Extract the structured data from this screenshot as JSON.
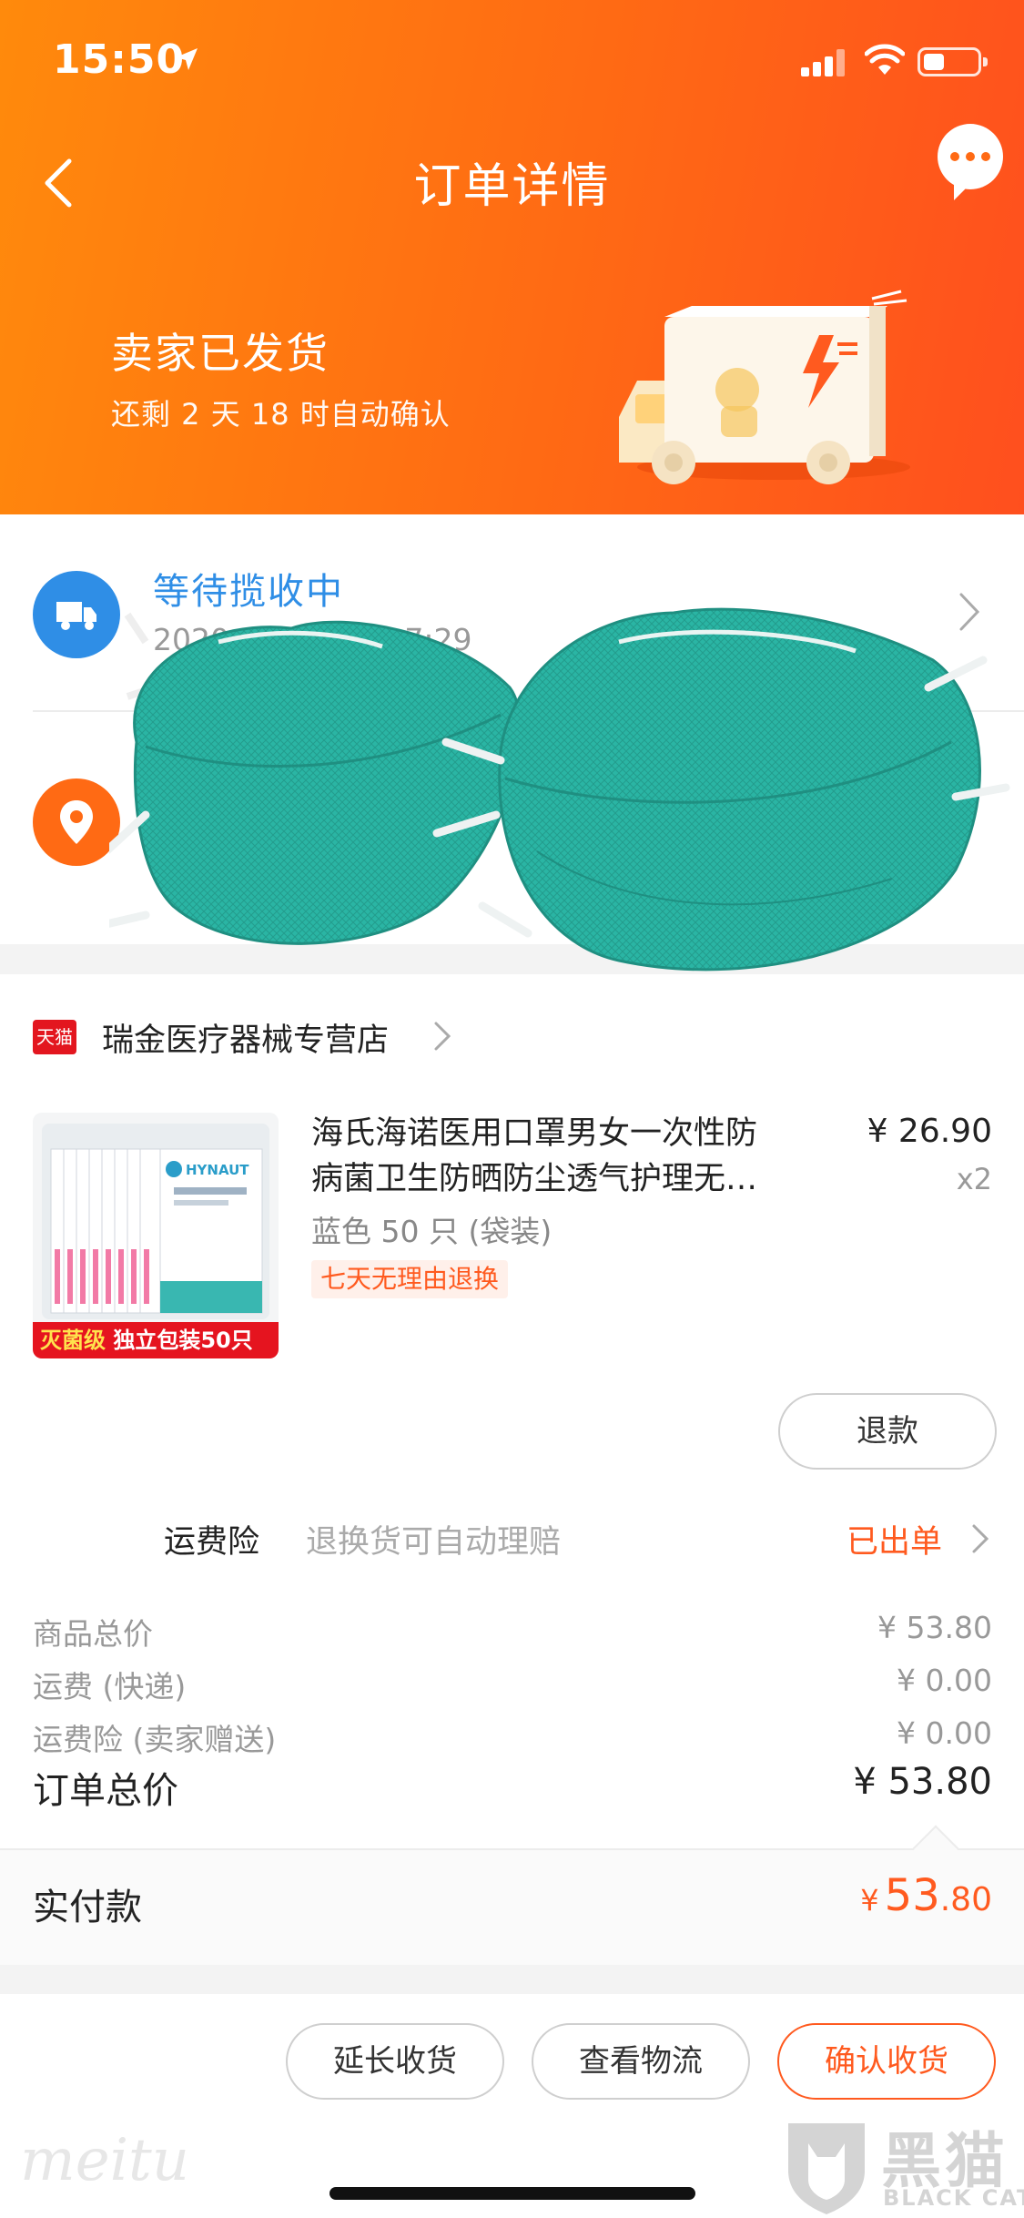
{
  "status_bar": {
    "time": "15:50"
  },
  "nav": {
    "title": "订单详情"
  },
  "hero": {
    "title": "卖家已发货",
    "subtitle": "还剩 2 天 18 时自动确认"
  },
  "logistics": {
    "status": "等待揽收中",
    "time": "2020-01-21 10:17:29"
  },
  "shop": {
    "badge": "天猫",
    "name": "瑞金医疗器械专营店"
  },
  "product": {
    "title_line1": "海氏海诺医用口罩男女一次性防",
    "title_line2": "病菌卫生防晒防尘透气护理无…",
    "price": "¥ 26.90",
    "quantity": "x2",
    "spec": "蓝色 50 只 (袋装)",
    "tag": "七天无理由退换",
    "thumb_badge_a": "灭菌级",
    "thumb_badge_b": " 独立包装50只",
    "thumb_brand": "HYNAUT"
  },
  "actions": {
    "refund": "退款"
  },
  "insurance": {
    "label": "运费险",
    "desc": "退换货可自动理赔",
    "status": "已出单"
  },
  "fees": [
    {
      "label": "商品总价",
      "value": "¥ 53.80"
    },
    {
      "label": "运费 (快递)",
      "value": "¥ 0.00"
    },
    {
      "label": "运费险 (卖家赠送)",
      "value": "¥ 0.00"
    }
  ],
  "total": {
    "label": "订单总价",
    "value": "¥ 53.80"
  },
  "paid": {
    "label": "实付款",
    "currency": "¥",
    "integer": "53",
    "decimal": ".80"
  },
  "bottom": {
    "extend": "延长收货",
    "track": "查看物流",
    "confirm": "确认收货"
  },
  "watermarks": {
    "meitu": "meitu",
    "blackcat": "黑猫",
    "blackcat_sub": "BLACK CAT"
  },
  "colors": {
    "accent": "#ff6a14",
    "blue": "#2f8ee6",
    "red": "#ff5a1f",
    "tmall": "#e3161f"
  }
}
